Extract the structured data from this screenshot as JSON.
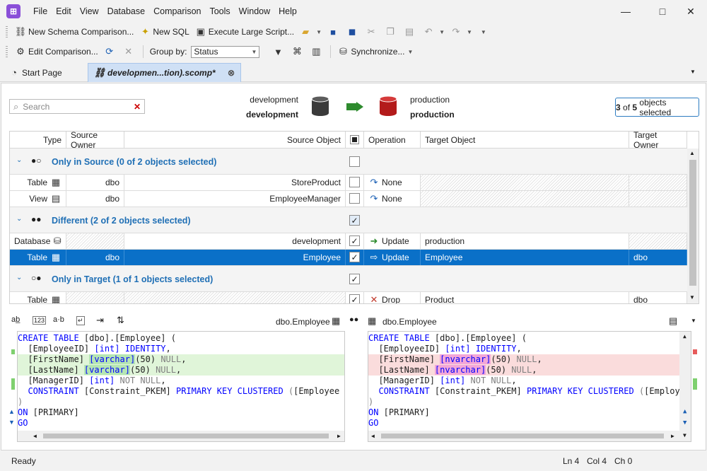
{
  "menu": [
    "File",
    "Edit",
    "View",
    "Database",
    "Comparison",
    "Tools",
    "Window",
    "Help"
  ],
  "toolbar1": {
    "new_schema_comparison": "New Schema Comparison...",
    "new_sql": "New SQL",
    "execute_large_script": "Execute Large Script..."
  },
  "toolbar2": {
    "edit_comparison": "Edit Comparison...",
    "group_by_label": "Group by:",
    "group_by_value": "Status",
    "synchronize": "Synchronize..."
  },
  "tabs": [
    {
      "label": "Start Page"
    },
    {
      "label": "developmen...tion).scomp*"
    }
  ],
  "search": {
    "placeholder": "Search"
  },
  "connections": {
    "source_label": "development",
    "source_name": "development",
    "target_label": "production",
    "target_name": "production"
  },
  "selection": {
    "selected": "3",
    "of": "of",
    "total": "5",
    "suffix": "objects selected"
  },
  "grid": {
    "columns": [
      "Type",
      "Source Owner",
      "Source Object",
      "Operation",
      "Target Object",
      "Target Owner"
    ],
    "groups": [
      {
        "title": "Only in Source (0 of 2 objects selected)",
        "rows": [
          {
            "type": "Table",
            "source_owner": "dbo",
            "source_object": "StoreProduct",
            "operation": "None",
            "target_object": "",
            "target_owner": ""
          },
          {
            "type": "View",
            "source_owner": "dbo",
            "source_object": "EmployeeManager",
            "operation": "None",
            "target_object": "",
            "target_owner": ""
          }
        ]
      },
      {
        "title": "Different (2 of 2 objects selected)",
        "rows": [
          {
            "type": "Database",
            "source_owner": "",
            "source_object": "development",
            "operation": "Update",
            "target_object": "production",
            "target_owner": ""
          },
          {
            "type": "Table",
            "source_owner": "dbo",
            "source_object": "Employee",
            "operation": "Update",
            "target_object": "Employee",
            "target_owner": "dbo"
          }
        ]
      },
      {
        "title": "Only in Target (1 of 1 objects selected)",
        "rows": [
          {
            "type": "Table",
            "source_owner": "",
            "source_object": "",
            "operation": "Drop",
            "target_object": "Product",
            "target_owner": "dbo"
          }
        ]
      }
    ]
  },
  "code": {
    "left_title": "dbo.Employee",
    "right_title": "dbo.Employee",
    "left_lines": [
      "CREATE TABLE [dbo].[Employee] (",
      "  [EmployeeID] [int] IDENTITY,",
      "  [FirstName] [varchar](50) NULL,",
      "  [LastName] [varchar](50) NULL,",
      "  [ManagerID] [int] NOT NULL,",
      "  CONSTRAINT [Constraint_PKEM] PRIMARY KEY CLUSTERED ([Employee",
      ")",
      "ON [PRIMARY]",
      "GO"
    ],
    "right_lines": [
      "CREATE TABLE [dbo].[Employee] (",
      "  [EmployeeID] [int] IDENTITY,",
      "  [FirstName] [nvarchar](50) NULL,",
      "  [LastName] [nvarchar](50) NULL,",
      "  [ManagerID] [int] NOT NULL,",
      "  CONSTRAINT [Constraint_PKEM] PRIMARY KEY CLUSTERED ([Employee",
      ")",
      "ON [PRIMARY]",
      "GO"
    ]
  },
  "status": {
    "text": "Ready",
    "ln": "Ln 4",
    "col": "Col 4",
    "ch": "Ch 0"
  },
  "colors": {
    "accent": "#0a70c8",
    "group_title": "#1f6fb5",
    "added": "#e0f5d9",
    "removed": "#fadcdc"
  }
}
